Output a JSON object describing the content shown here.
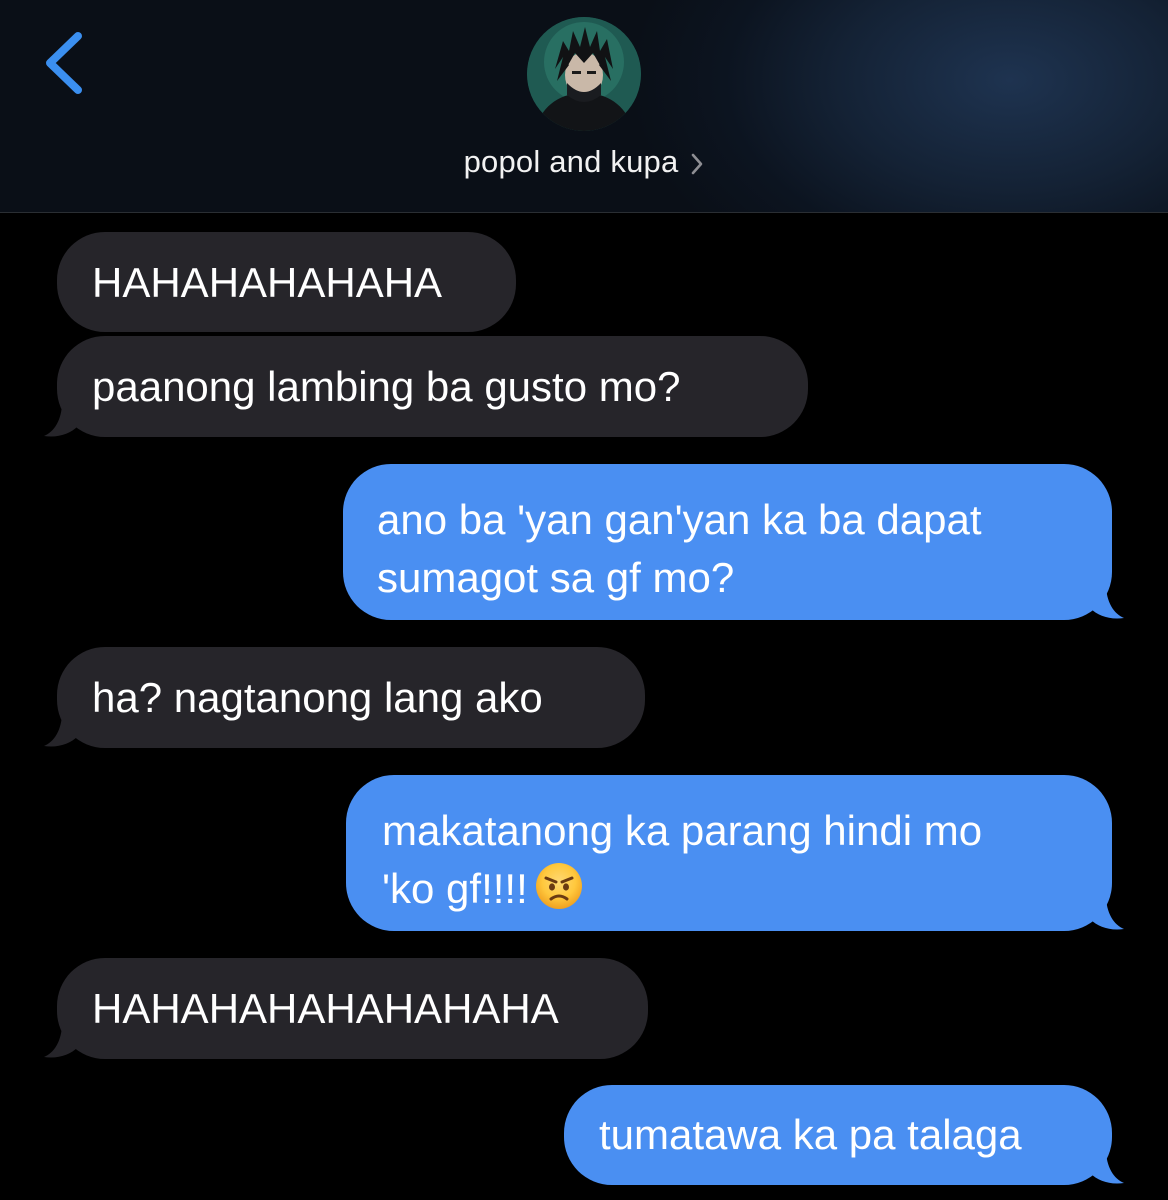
{
  "header": {
    "contact_name": "popol and kupa",
    "back_icon": "chevron-left-icon",
    "details_icon": "chevron-right-icon",
    "accent_color": "#3b8ff0"
  },
  "messages": [
    {
      "direction": "incoming",
      "text": "HAHAHAHAHAHA"
    },
    {
      "direction": "incoming",
      "text": "paanong lambing ba gusto mo?"
    },
    {
      "direction": "outgoing",
      "lines": [
        "ano ba 'yan gan'yan ka ba dapat",
        "sumagot sa gf mo?"
      ]
    },
    {
      "direction": "incoming",
      "text": "ha? nagtanong lang ako"
    },
    {
      "direction": "outgoing",
      "lines": [
        "makatanong ka parang hindi mo",
        "'ko gf!!!!"
      ],
      "emoji": "angry-face"
    },
    {
      "direction": "incoming",
      "text": "HAHAHAHAHAHAHAHA"
    },
    {
      "direction": "outgoing",
      "text": "tumatawa ka pa talaga"
    }
  ],
  "colors": {
    "incoming_bubble": "#26252a",
    "outgoing_bubble": "#4a8ff2",
    "background": "#000000"
  }
}
